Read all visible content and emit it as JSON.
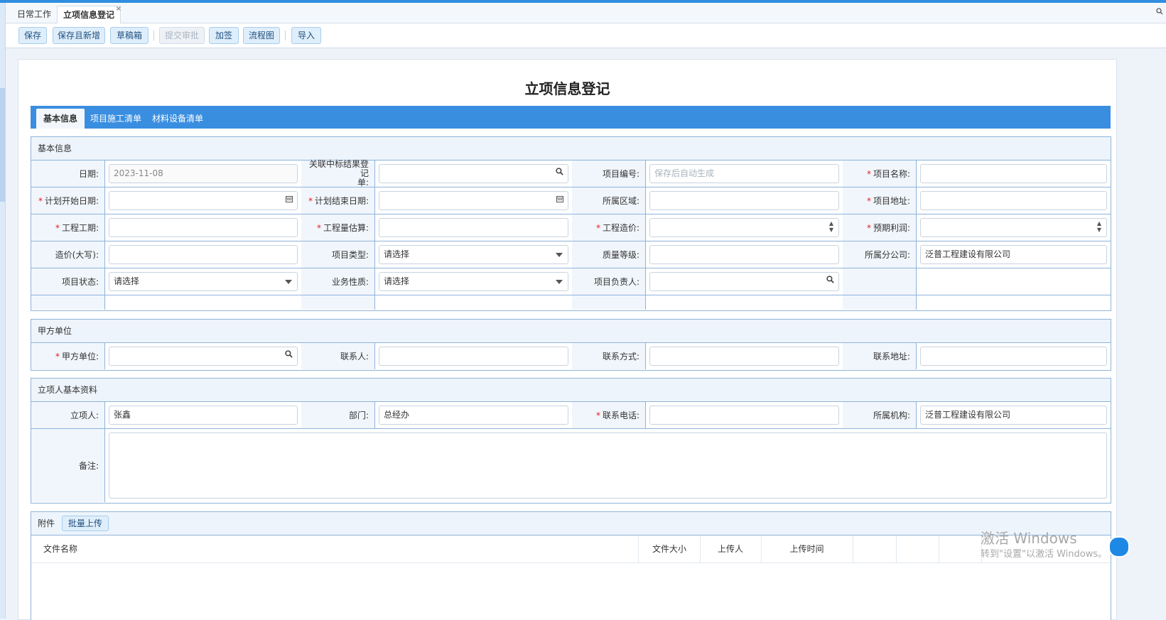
{
  "tabs": [
    {
      "label": "日常工作"
    },
    {
      "label": "立项信息登记",
      "active": true,
      "close": "×"
    }
  ],
  "toolbar": {
    "save": "保存",
    "save_new": "保存且新增",
    "draft": "草稿箱",
    "submit": "提交审批",
    "countersign": "加签",
    "flowchart": "流程图",
    "import": "导入"
  },
  "page_title": "立项信息登记",
  "form_tabs": [
    {
      "label": "基本信息",
      "active": true
    },
    {
      "label": "项目施工清单"
    },
    {
      "label": "材料设备清单"
    }
  ],
  "basic": {
    "header": "基本信息",
    "date_label": "日期:",
    "date_value": "2023-11-08",
    "bid_label_1": "关联中标结果登记",
    "bid_label_2": "单:",
    "code_label": "项目编号:",
    "code_placeholder": "保存后自动生成",
    "name_label": "项目名称:",
    "start_label": "计划开始日期:",
    "end_label": "计划结束日期:",
    "region_label": "所属区域:",
    "address_label": "项目地址:",
    "period_label": "工程工期:",
    "quantity_label": "工程量估算:",
    "cost_label": "工程造价:",
    "profit_label": "预期利润:",
    "cost_upper_label": "造价(大写):",
    "type_label": "项目类型:",
    "type_value": "请选择",
    "quality_label": "质量等级:",
    "branch_label": "所属分公司:",
    "branch_value": "泛普工程建设有限公司",
    "status_label": "项目状态:",
    "status_value": "请选择",
    "nature_label": "业务性质:",
    "nature_value": "请选择",
    "manager_label": "项目负责人:"
  },
  "party": {
    "header": "甲方单位",
    "unit_label": "甲方单位:",
    "contact_label": "联系人:",
    "method_label": "联系方式:",
    "address_label": "联系地址:"
  },
  "applicant": {
    "header": "立项人基本资料",
    "person_label": "立项人:",
    "person_value": "张鑫",
    "dept_label": "部门:",
    "dept_value": "总经办",
    "phone_label": "联系电话:",
    "org_label": "所属机构:",
    "org_value": "泛普工程建设有限公司",
    "remark_label": "备注:"
  },
  "attachments": {
    "header": "附件",
    "batch_upload": "批量上传",
    "col_name": "文件名称",
    "col_size": "文件大小",
    "col_uploader": "上传人",
    "col_time": "上传时间"
  },
  "watermark": {
    "line1": "激活 Windows",
    "line2": "转到\"设置\"以激活 Windows。"
  },
  "icons": {
    "search": "🔍",
    "calendar": "▦",
    "spin": "▲▼"
  },
  "colors": {
    "accent": "#3a8ee0",
    "border": "#8fb4d9",
    "required": "#e02020"
  }
}
